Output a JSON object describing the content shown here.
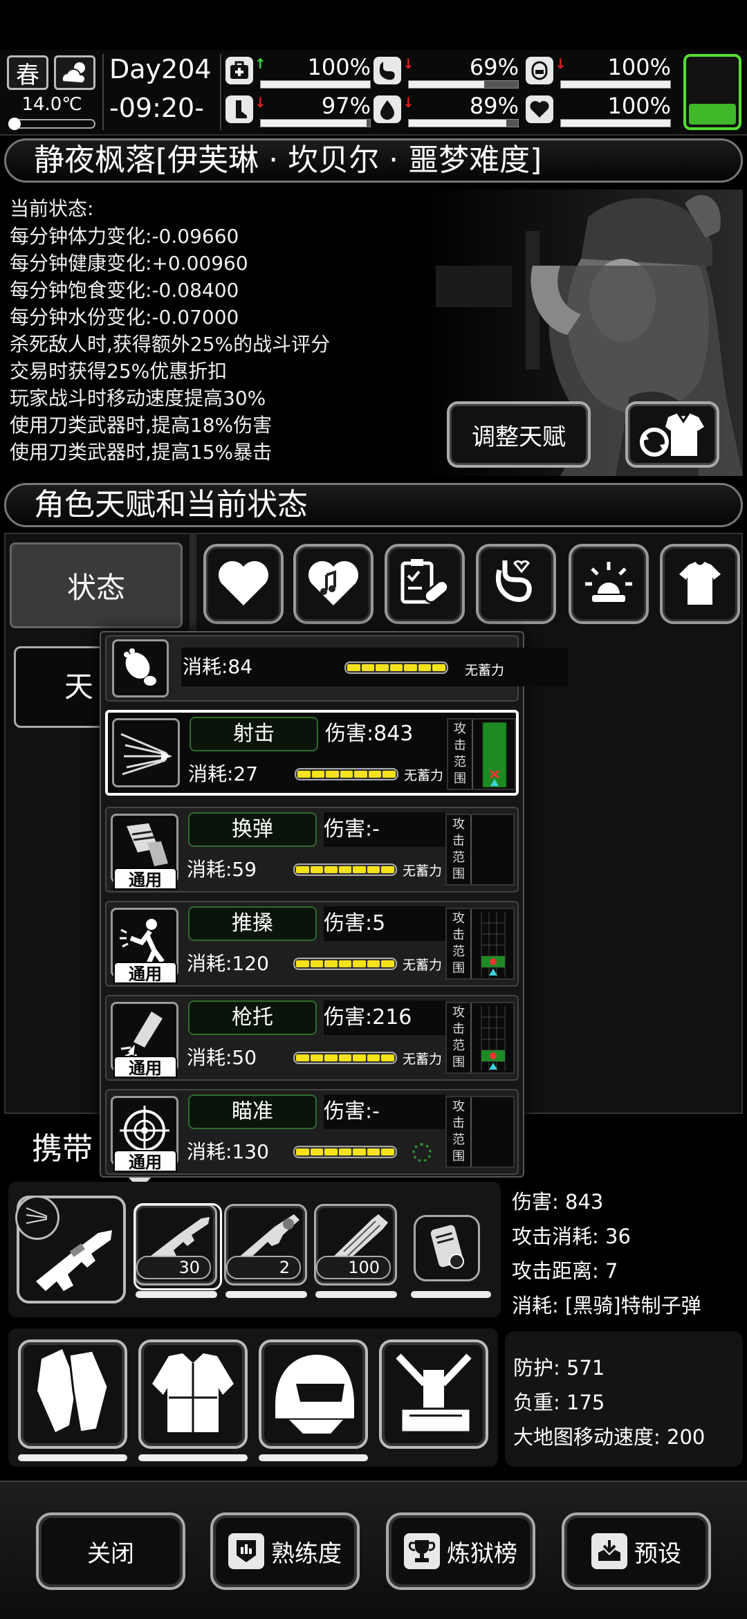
{
  "topbar": {
    "season": "春",
    "temperature": "14.0℃",
    "day": "Day204",
    "time": "-09:20-",
    "stats": [
      {
        "name": "medkit",
        "value": "100%",
        "level": 1.0,
        "trend": "up"
      },
      {
        "name": "stomach",
        "value": "69%",
        "level": 0.69,
        "trend": "down"
      },
      {
        "name": "bladder",
        "value": "100%",
        "level": 1.0,
        "trend": "down"
      },
      {
        "name": "stamina-leg",
        "value": "97%",
        "level": 0.97,
        "trend": "down"
      },
      {
        "name": "water-drop",
        "value": "89%",
        "level": 0.89,
        "trend": "down"
      },
      {
        "name": "heart",
        "value": "100%",
        "level": 1.0,
        "trend": "none"
      }
    ]
  },
  "character": {
    "title": "静夜枫落[伊芙琳 · 坎贝尔 · 噩梦难度]",
    "status_heading": "当前状态:",
    "status_lines": [
      "每分钟体力变化:-0.09660",
      "每分钟健康变化:+0.00960",
      "每分钟饱食变化:-0.08400",
      "每分钟水份变化:-0.07000",
      "杀死敌人时,获得额外25%的战斗评分",
      "交易时获得25%优惠折扣",
      "玩家战斗时移动速度提高30%",
      "使用刀类武器时,提高18%伤害",
      "使用刀类武器时,提高15%暴击"
    ],
    "adjust_talent_label": "调整天赋"
  },
  "talent_section": {
    "title": "角色天赋和当前状态",
    "tab_state": "状态",
    "tab_talent": "天"
  },
  "skills": {
    "walk": {
      "cost": "消耗:84",
      "note": "无蓄力"
    },
    "list": [
      {
        "name": "射击",
        "damage": "伤害:843",
        "cost": "消耗:27",
        "note": "无蓄力",
        "tag": "",
        "range_label": [
          "攻",
          "击",
          "范",
          "围"
        ],
        "selected": true
      },
      {
        "name": "换弹",
        "damage": "伤害:-",
        "cost": "消耗:59",
        "note": "无蓄力",
        "tag": "通用",
        "range_label": [
          "攻",
          "击",
          "范",
          "围"
        ]
      },
      {
        "name": "推搡",
        "damage": "伤害:5",
        "cost": "消耗:120",
        "note": "无蓄力",
        "tag": "通用",
        "range_label": [
          "攻",
          "击",
          "范",
          "围"
        ]
      },
      {
        "name": "枪托",
        "damage": "伤害:216",
        "cost": "消耗:50",
        "note": "无蓄力",
        "tag": "通用",
        "range_label": [
          "攻",
          "击",
          "范",
          "围"
        ]
      },
      {
        "name": "瞄准",
        "damage": "伤害:-",
        "cost": "消耗:130",
        "note": "",
        "tag": "通用",
        "range_label": [
          "攻",
          "击",
          "范",
          "围"
        ]
      }
    ]
  },
  "carry": {
    "title": "携带",
    "weapons": [
      {
        "count": "30"
      },
      {
        "count": "2"
      },
      {
        "count": "100"
      }
    ],
    "weapon_stats": [
      "伤害: 843",
      "攻击消耗: 36",
      "攻击距离: 7",
      "消耗: [黑骑]特制子弹"
    ],
    "armor_stats": [
      "防护: 571",
      "负重: 175",
      "大地图移动速度: 200"
    ]
  },
  "bottom": {
    "close": "关闭",
    "proficiency": "熟练度",
    "ranking": "炼狱榜",
    "preset": "预设"
  },
  "colors": {
    "accent_green": "#55dd33",
    "bar_yellow": "#f4e21a",
    "trend_up": "#3ddc3d",
    "trend_down": "#e02020"
  }
}
